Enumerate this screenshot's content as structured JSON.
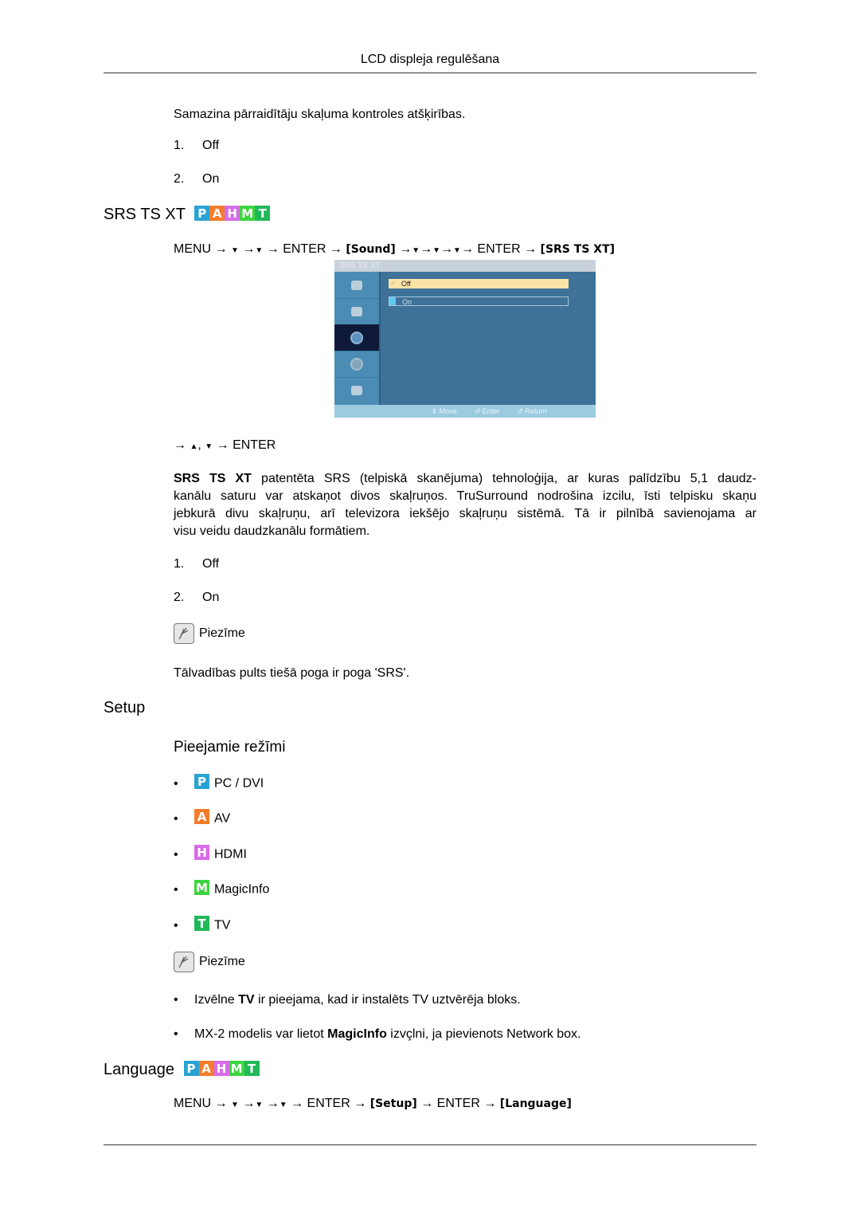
{
  "header": {
    "title": "LCD displeja regulēšana"
  },
  "intro": {
    "text": "Samazina pārraidītāju skaļuma kontroles atšķirības.",
    "options": [
      {
        "num": "1.",
        "label": "Off"
      },
      {
        "num": "2.",
        "label": "On"
      }
    ]
  },
  "srs": {
    "title": "SRS TS XT",
    "badges": [
      "P",
      "A",
      "H",
      "M",
      "T"
    ],
    "path": {
      "menu": "MENU",
      "arrow": "→",
      "down": "▼",
      "up": "▲",
      "enter": "ENTER",
      "sound": "[Sound]",
      "target": "[SRS TS XT]"
    },
    "osd": {
      "title": "SRS TS XT",
      "options": [
        {
          "label": "Off",
          "selected": true,
          "mark": "✓"
        },
        {
          "label": "On",
          "selected": false
        }
      ],
      "sidebar_icons": [
        "picture-icon",
        "input-icon",
        "sound-icon",
        "setup-icon",
        "multi-control-icon"
      ],
      "selected_sidebar_index": 2,
      "footer": {
        "move": "⇕ Move",
        "enter": "⏎ Enter",
        "return": "↺ Return"
      }
    },
    "nav_hint": {
      "prefix": "→",
      "up": "▲",
      "sep": ",",
      "down": "▼",
      "suffix": "→ ENTER"
    },
    "desc_bold": "SRS TS XT",
    "desc_line1": " patentēta SRS (telpiskā skanējuma) tehnoloģija, ar kuras palīdzību 5,1 daudz-",
    "desc_line2": "kanālu saturu var atskaņot divos skaļruņos. TruSurround nodrošina izcilu, īsti telpisku skaņu",
    "desc_line3": "jebkurā divu skaļruņu, arī televizora iekšējo skaļruņu sistēmā. Tā ir pilnībā savienojama ar",
    "desc_line4": "visu veidu daudzkanālu formātiem.",
    "options": [
      {
        "num": "1.",
        "label": "Off"
      },
      {
        "num": "2.",
        "label": "On"
      }
    ],
    "note_label": "Piezīme",
    "note_text": "Tālvadības pults tiešā poga ir poga 'SRS'."
  },
  "setup": {
    "title": "Setup",
    "subtitle": "Pieejamie režīmi",
    "modes": [
      {
        "badge": "P",
        "label": "PC / DVI",
        "color": "#2aa3d4"
      },
      {
        "badge": "A",
        "label": "AV",
        "color": "#f47c2a"
      },
      {
        "badge": "H",
        "label": "HDMI",
        "color": "#d86ce8"
      },
      {
        "badge": "M",
        "label": "MagicInfo",
        "color": "#3dd53f"
      },
      {
        "badge": "T",
        "label": "TV",
        "color": "#22b85a"
      }
    ],
    "note_label": "Piezīme",
    "notes": [
      {
        "pre": "Izvēlne ",
        "bold": "TV",
        "post": " ir pieejama, kad ir instalēts TV uztvērēja bloks."
      },
      {
        "pre": "MX-2 modelis var lietot ",
        "bold": "MagicInfo",
        "post": " izvçlni, ja pievienots Network box."
      }
    ]
  },
  "language": {
    "title": "Language",
    "badges": [
      "P",
      "A",
      "H",
      "M",
      "T"
    ],
    "path": {
      "menu": "MENU",
      "arrow": "→",
      "down": "▼",
      "enter": "ENTER",
      "setup": "[Setup]",
      "target": "[Language]"
    }
  }
}
